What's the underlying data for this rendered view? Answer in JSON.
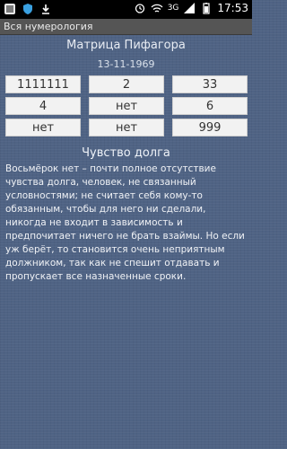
{
  "status_bar": {
    "network": "3G",
    "time": "17:53",
    "icons": [
      "app-icon",
      "shield-icon",
      "download-icon",
      "alarm-icon",
      "wifi-icon",
      "signal-icon",
      "battery-icon"
    ]
  },
  "app": {
    "title": "Вся нумерология"
  },
  "header": {
    "title": "Матрица Пифагора",
    "date": "13-11-1969"
  },
  "matrix": {
    "rows": [
      [
        "1111111",
        "2",
        "33"
      ],
      [
        "4",
        "нет",
        "6"
      ],
      [
        "нет",
        "нет",
        "999"
      ]
    ]
  },
  "section": {
    "title": "Чувство долга",
    "text": "Восьмёрок нет – почти полное отсутствие чувства долга, человек, не связанный условностями; не считает себя кому-то обязанным, чтобы для него ни сделали, никогда не входит в зависимость и предпочитает ничего не брать взаймы. Но если уж берёт, то становится очень неприятным должником, так как не спешит отдавать и пропускает все назначенные сроки."
  },
  "colors": {
    "background": "#4f6384",
    "cell_bg": "#f2f2f2",
    "appbar": "#555555"
  }
}
